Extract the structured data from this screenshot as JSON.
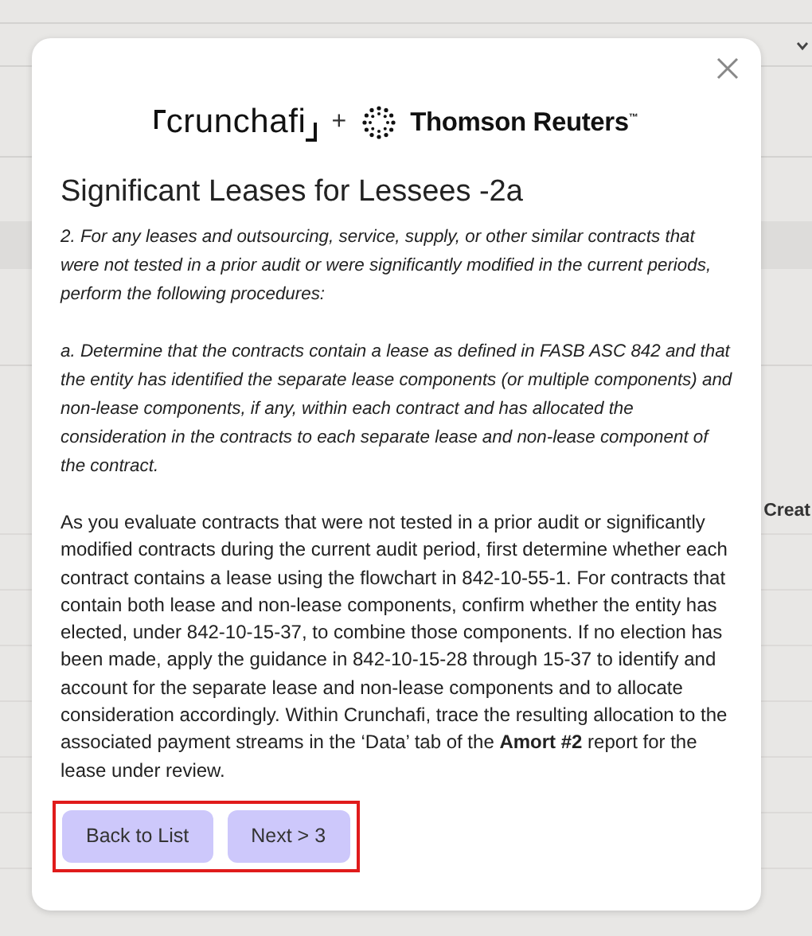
{
  "background": {
    "column_header": "Creat"
  },
  "dialog": {
    "logos": {
      "primary": "crunchafi",
      "separator": "+",
      "partner": "Thomson Reuters",
      "trademark": "™"
    },
    "title": "Significant Leases for Lessees -2a",
    "paragraphs": [
      {
        "kind": "italic",
        "text": "2. For any leases and outsourcing, service, supply, or other similar contracts that were not tested in a prior audit or were significantly modified in the current periods, perform the following procedures:"
      },
      {
        "kind": "italic",
        "text": "a. Determine that the contracts contain a lease as defined in FASB ASC 842 and that the entity has identified the separate lease components (or multiple components) and non-lease components, if any, within each contract and has allocated the consideration in the contracts to each separate lease and non-lease component of the contract."
      },
      {
        "kind": "plain",
        "text": "As you evaluate contracts that were not tested in a prior audit or significantly modified contracts during the current audit period, first determine whether each contract contains a lease using the flowchart in 842-10-55-1. For contracts that contain both lease and non-lease components, confirm whether the entity has elected, under 842-10-15-37, to combine those components. If no election has been made, apply the guidance in 842-10-15-28 through 15-37 to identify and account for the separate lease and non-lease components and to allocate consideration accordingly. Within Crunchafi, trace the resulting allocation to the associated payment streams in the ‘Data’ tab of the **Amort #2** report for the lease under review."
      }
    ],
    "buttons": [
      {
        "label": "Back to List"
      },
      {
        "label": "Next > 3"
      }
    ],
    "buttons_highlighted": true
  }
}
